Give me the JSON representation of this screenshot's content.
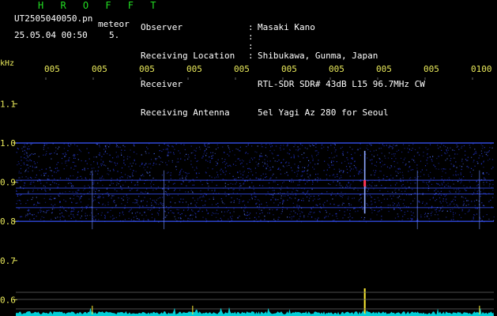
{
  "header": {
    "app_title": "H R O F F T",
    "filename": "UT2505040050.pn",
    "meteor_label": "meteor",
    "datetime": "25.05.04 00:50",
    "count": "5.",
    "info": [
      {
        "label": "Observer",
        "value": "Masaki Kano"
      },
      {
        "label": "Receiving Location",
        "value": "Shibukawa, Gunma, Japan"
      },
      {
        "label": "Receiver",
        "value": "RTL-SDR SDR# 43dB L15 96.7MHz CW"
      },
      {
        "label": "Receiving Antenna",
        "value": "5el Yagi Az 280 for Seoul"
      }
    ]
  },
  "spectrogram": {
    "unit_label": "kHz",
    "time_labels": [
      "005",
      "005",
      "005",
      "005",
      "005",
      "005",
      "005",
      "005",
      "005",
      "0100"
    ],
    "freq_labels": [
      "1.1",
      "1.0",
      "0.9",
      "0.8",
      "0.7",
      "0.6"
    ],
    "freq_ticks": [
      1.1,
      1.0,
      0.9,
      0.8,
      0.7,
      0.6
    ],
    "band_khz": [
      0.8,
      1.0
    ],
    "meteor_echoes": [
      {
        "minute_fraction": 0.73,
        "khz": 0.9
      }
    ],
    "colors": {
      "background": "#000000",
      "noise": "#2233cc",
      "band_line": "#3a55ff",
      "grid": "#666666",
      "trace": "#00e5ee",
      "axis_text": "#e8e85a"
    }
  }
}
